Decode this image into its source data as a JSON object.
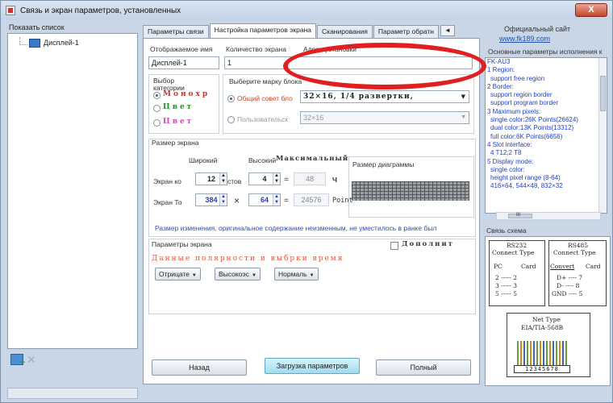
{
  "window": {
    "title": "Связь и экран параметров, установленных",
    "close": "X"
  },
  "left": {
    "label": "Показать список",
    "tree_item": "Дисплей-1"
  },
  "tabs": [
    "Параметры связи",
    "Настройка параметров экрана",
    "Сканирования",
    "Параметр обратн"
  ],
  "tab_scroll": "◄ ►",
  "screen": {
    "display_name_label": "Отображаемое имя",
    "screen_count_label": "Количество экрана",
    "address_label": "Адрес установки",
    "display_name_value": "Дисплей-1",
    "screen_count_value": "1",
    "address_value": "",
    "category_label": "Выбор категории",
    "monochrome": "Монохр",
    "two_color": "Цвет",
    "three_color": "Цвет",
    "card_label": "Выберите марку блока",
    "common_card": "Общий совет бло",
    "common_card_value": "32×16, 1/4 развертки,",
    "custom_card": "Пользовательск",
    "custom_card_value": "32×16"
  },
  "size": {
    "title": "Размер экрана",
    "width_label": "Широкий",
    "height_label": "Высокий",
    "max_label": "Максимальный",
    "preview_label": "Размер диаграммы",
    "row1_label": "Экран ко",
    "row1_w": "12",
    "row1_unit": "стов",
    "row1_h": "4",
    "row1_eq": "=",
    "row1_result": "48",
    "row1_tail": "Ч",
    "row2_label": "Экран То",
    "row2_w": "384",
    "row2_x": "×",
    "row2_h": "64",
    "row2_eq": "=",
    "row2_result": "24576",
    "row2_tail": "Point",
    "info": "Размер изменения, оригинальное содержание неизменным, не уместилось в ранке был"
  },
  "params": {
    "title": "Параметры экрана",
    "extra_check": "Дополнит",
    "data_line": "Данные полярности и выбрки время",
    "btn1": "Отрицате",
    "btn2": "Высокоэс",
    "btn3": "Нормаль"
  },
  "buttons": {
    "back": "Назад",
    "upload": "Загрузка параметров",
    "finish": "Полный"
  },
  "right": {
    "official_site_label": "Официальный сайт",
    "official_site_link": "www.fk189.com",
    "params_label": "Основные параметры исполнения к",
    "model": "FK-AU3",
    "lines": [
      {
        "t": "1 Region:",
        "ind": false
      },
      {
        "t": "support free region",
        "ind": true
      },
      {
        "t": "2 Border:",
        "ind": false
      },
      {
        "t": "support region border",
        "ind": true
      },
      {
        "t": "support program border",
        "ind": true
      },
      {
        "t": "3 Maximum pixels:",
        "ind": false
      },
      {
        "t": "single color:26K Points(26624)",
        "ind": true
      },
      {
        "t": "dual color:13K Points(13312)",
        "ind": true
      },
      {
        "t": "full color:6K Points(6656)",
        "ind": true
      },
      {
        "t": "4 Slot interface:",
        "ind": false
      },
      {
        "t": "4 T12;2 T8",
        "ind": true
      },
      {
        "t": "5 Display mode:",
        "ind": false
      },
      {
        "t": "single color:",
        "ind": true
      },
      {
        "t": "height pixel range (8-64)",
        "ind": true
      },
      {
        "t": "416×64, 544×48, 832×32",
        "ind": true
      }
    ],
    "hscroll_mark": "III",
    "diagram_label": "Связь схема",
    "rs232_title": "RS232",
    "rs232_sub": "Connect Type",
    "rs232_pc": "PC",
    "rs232_card": "Card",
    "rs232_rows": [
      "2 ----- 2",
      "3 ----- 3",
      "5 ----- 5"
    ],
    "rs485_title": "RS485",
    "rs485_sub": "Connect Type",
    "rs485_convert": "Convert",
    "rs485_card": "Card",
    "rs485_rows": [
      "D+ ---- 7",
      "D- ---- 8",
      "GND ---- 5"
    ],
    "net_title": "Net Type",
    "net_sub": "EIA/TIA-568B",
    "pins": "12345678"
  },
  "colors": {
    "annotation": "#e02020",
    "link": "#1e4fb0",
    "info": "#2a4fb0"
  }
}
